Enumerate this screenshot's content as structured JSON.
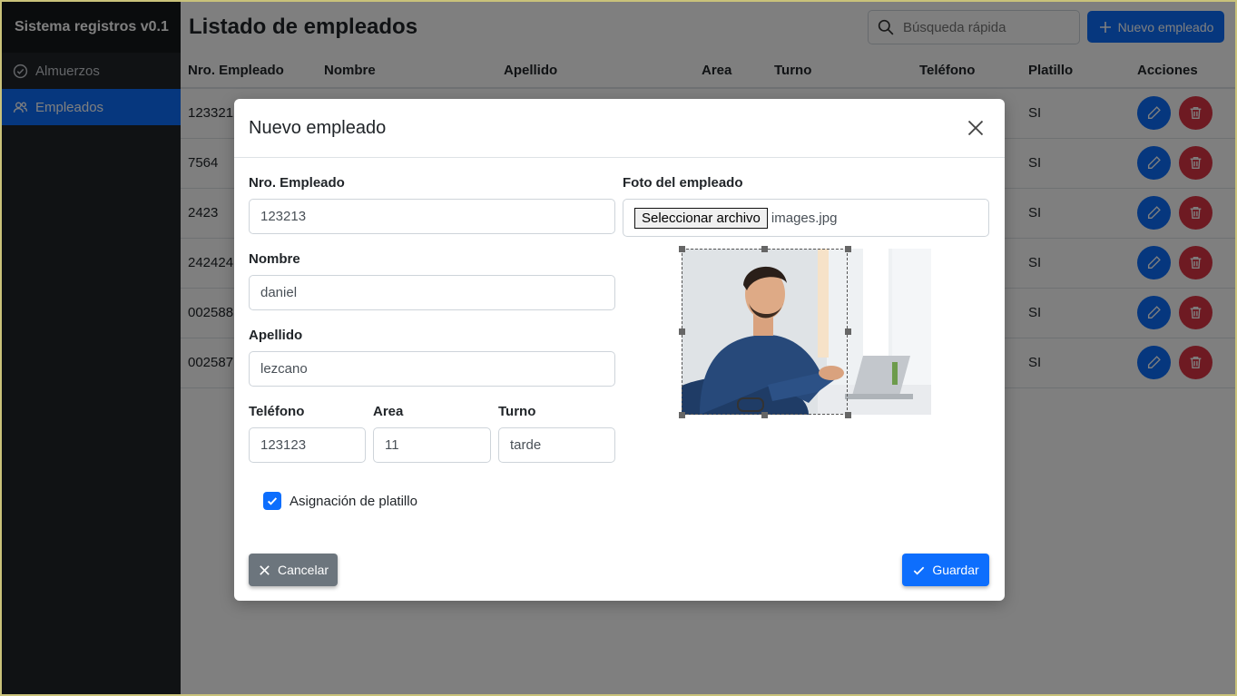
{
  "sidebar": {
    "brand": "Sistema registros v0.1",
    "items": [
      {
        "label": "Almuerzos",
        "icon": "check-circle-icon"
      },
      {
        "label": "Empleados",
        "icon": "users-icon"
      }
    ]
  },
  "header": {
    "title": "Listado de empleados",
    "search_placeholder": "Búsqueda rápida",
    "new_button": "Nuevo empleado"
  },
  "table": {
    "columns": [
      "Nro. Empleado",
      "Nombre",
      "Apellido",
      "Area",
      "Turno",
      "Teléfono",
      "Platillo",
      "Acciones"
    ],
    "rows": [
      {
        "nro": "123321",
        "platillo": "SI"
      },
      {
        "nro": "7564",
        "platillo": "SI"
      },
      {
        "nro": "2423",
        "platillo": "SI"
      },
      {
        "nro": "242424",
        "platillo": "SI"
      },
      {
        "nro": "002588",
        "platillo": "SI"
      },
      {
        "nro": "002587",
        "platillo": "SI"
      }
    ]
  },
  "modal": {
    "title": "Nuevo empleado",
    "fields": {
      "nro_label": "Nro. Empleado",
      "nro_value": "123213",
      "nombre_label": "Nombre",
      "nombre_value": "daniel",
      "apellido_label": "Apellido",
      "apellido_value": "lezcano",
      "telefono_label": "Teléfono",
      "telefono_value": "123123",
      "area_label": "Area",
      "area_value": "11",
      "turno_label": "Turno",
      "turno_value": "tarde",
      "foto_label": "Foto del empleado",
      "file_button": "Seleccionar archivo",
      "file_name": "images.jpg"
    },
    "checkbox_label": "Asignación de platillo",
    "checkbox_checked": true,
    "cancel_label": "Cancelar",
    "save_label": "Guardar"
  },
  "colors": {
    "primary": "#0d6efd",
    "danger": "#dc3545",
    "secondary": "#6c757d",
    "sidebar": "#212529"
  }
}
